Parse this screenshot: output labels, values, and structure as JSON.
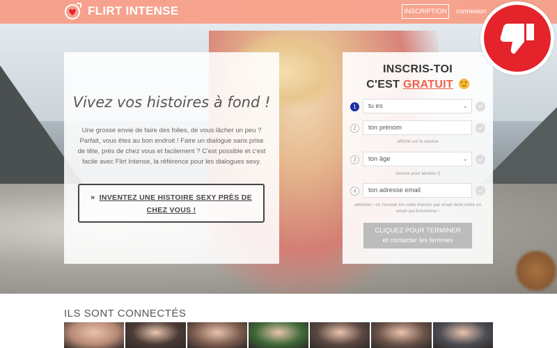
{
  "header": {
    "brand": "FLIRT INTENSE",
    "inscription_label": "INSCRIPTION",
    "connexion_label": "connexion",
    "background_color": "#f6a08e"
  },
  "hero": {
    "tagline": "Vivez vos histoires à fond !",
    "pitch": "Une grosse envie de faire des folies, de vous lâcher un peu ? Parfait, vous êtes au bon endroit ! Faire un dialogue sans prise de tête, près de chez vous et facilement ? C'est possible et c'est facile avec Flirt Intense, la référence pour les dialogues sexy.",
    "cta_label": "INVENTEZ UNE HISTOIRE SEXY PRÈS DE CHEZ VOUS !"
  },
  "form": {
    "title_line1": "INSCRIS-TOI",
    "title_line2_prefix": "C'EST",
    "title_line2_highlight": "GRATUIT",
    "accent_color": "#f0614b",
    "steps": [
      {
        "number": "1",
        "value": "tu es",
        "type": "select",
        "hint": ""
      },
      {
        "number": "2",
        "value": "ton prénom",
        "type": "input",
        "hint": "affiché sur le service"
      },
      {
        "number": "3",
        "value": "ton âge",
        "type": "select",
        "hint": "service pour adultes !)"
      },
      {
        "number": "4",
        "value": "ton adresse email",
        "type": "input",
        "hint": "attention : on t'envoie ton code d'accès par email donc entre un email qui fonctionne !"
      }
    ],
    "submit_line1": "CLIQUEZ POUR TERMINER",
    "submit_line2": "et contacter les femmes"
  },
  "connected": {
    "title": "ILS SONT CONNECTÉS",
    "thumbs": [
      {
        "color": "#b88a76"
      },
      {
        "color": "#4a3a35"
      },
      {
        "color": "#7d5d4f"
      },
      {
        "color": "#3f6a3a"
      },
      {
        "color": "#5a4740"
      },
      {
        "color": "#6b5248"
      },
      {
        "color": "#4d4d55"
      }
    ]
  },
  "badge": {
    "icon": "thumbs-down-icon",
    "color": "#e4232b"
  }
}
